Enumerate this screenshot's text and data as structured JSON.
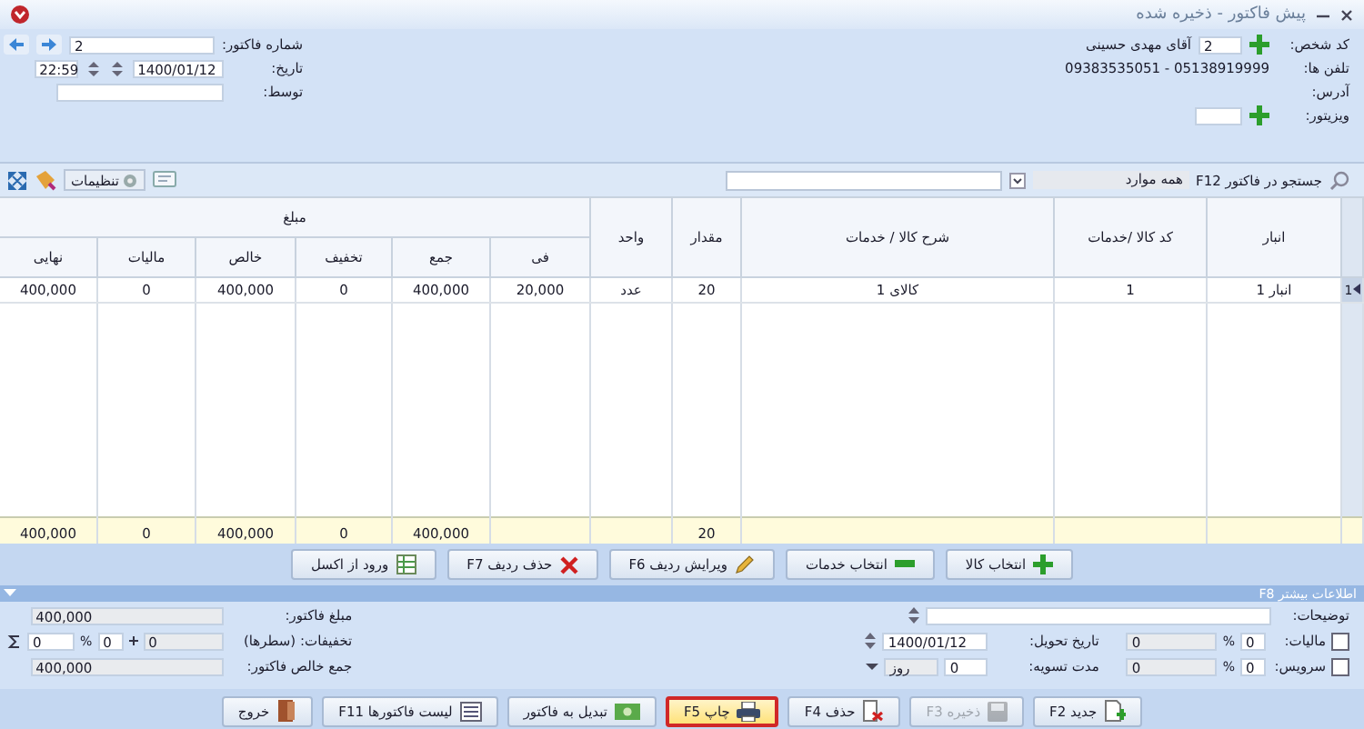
{
  "window": {
    "title": "پیش فاکتور - ذخیره شده"
  },
  "invoice": {
    "number_label": "شماره فاکتور:",
    "number": "2",
    "date_label": "تاریخ:",
    "date": "1400/01/12",
    "time": "22:59",
    "by_label": "توسط:"
  },
  "customer": {
    "code_label": "کد شخص:",
    "code": "2",
    "name": "آقای مهدی حسینی",
    "phones_label": "تلفن ها:",
    "phones": "09383535051 - 05138919999",
    "address_label": "آدرس:",
    "visitor_label": "ویزیتور:"
  },
  "toolbar": {
    "search_label": "جستجو در فاکتور F12",
    "scope": "همه موارد",
    "settings": "تنظیمات"
  },
  "table": {
    "columns": [
      {
        "label": "انبار"
      },
      {
        "label": "کد کالا /خدمات"
      },
      {
        "label": "شرح کالا / خدمات"
      },
      {
        "label": "مقدار",
        "total": "20"
      },
      {
        "label": "واحد"
      }
    ],
    "amount_group": {
      "label": "مبلغ",
      "columns": [
        {
          "label": "فی"
        },
        {
          "label": "جمع",
          "total": "400,000"
        },
        {
          "label": "تخفیف",
          "total": "0"
        },
        {
          "label": "خالص",
          "total": "400,000"
        },
        {
          "label": "مالیات",
          "total": "0"
        },
        {
          "label": "نهایی",
          "total": "400,000"
        }
      ]
    },
    "rows": [
      {
        "number": "1",
        "selected": true,
        "cells": [
          "انبار 1",
          "1",
          "کالای 1",
          "20",
          "عدد",
          "20,000",
          "400,000",
          "0",
          "400,000",
          "0",
          "400,000"
        ]
      }
    ]
  },
  "row_buttons": [
    "انتخاب کالا",
    "انتخاب خدمات",
    "ویرایش ردیف F6",
    "حذف ردیف F7",
    "ورود از اکسل"
  ],
  "more_info": {
    "title": "اطلاعات بیشتر F8",
    "expanded": true
  },
  "details": {
    "notes_label": "توضیحات:",
    "tax": {
      "label": "مالیات:",
      "checked": false,
      "percent": "0",
      "percent_sign": "%",
      "amount": "0"
    },
    "service": {
      "label": "سرویس:",
      "checked": false,
      "percent": "0",
      "percent_sign": "%",
      "amount": "0"
    },
    "delivery_label": "تاریخ تحویل:",
    "delivery_date": "1400/01/12",
    "settlement_label": "مدت تسویه:",
    "settlement_days": "0",
    "settlement_unit": "روز",
    "invoice_amount_label": "مبلغ فاکتور:",
    "invoice_amount": "400,000",
    "discounts_label": "تخفیفات: (سطرها)",
    "discount_rows": "0",
    "discount_percent": "0",
    "discount_percent_sign": "%",
    "discount_extra": "0",
    "net_total_label": "جمع خالص فاکتور:",
    "net_total": "400,000"
  },
  "bottom_buttons": [
    {
      "label": "جدید F2",
      "disabled": false,
      "focused": false
    },
    {
      "label": "ذخیره F3",
      "disabled": true,
      "focused": false
    },
    {
      "label": "حذف F4",
      "disabled": false,
      "focused": false
    },
    {
      "label": "چاپ F5",
      "disabled": false,
      "focused": true
    },
    {
      "label": "تبدیل به فاکتور",
      "disabled": false,
      "focused": false
    },
    {
      "label": "لیست فاکتورها F11",
      "disabled": false,
      "focused": false
    },
    {
      "label": "خروج",
      "disabled": false,
      "focused": false
    }
  ]
}
